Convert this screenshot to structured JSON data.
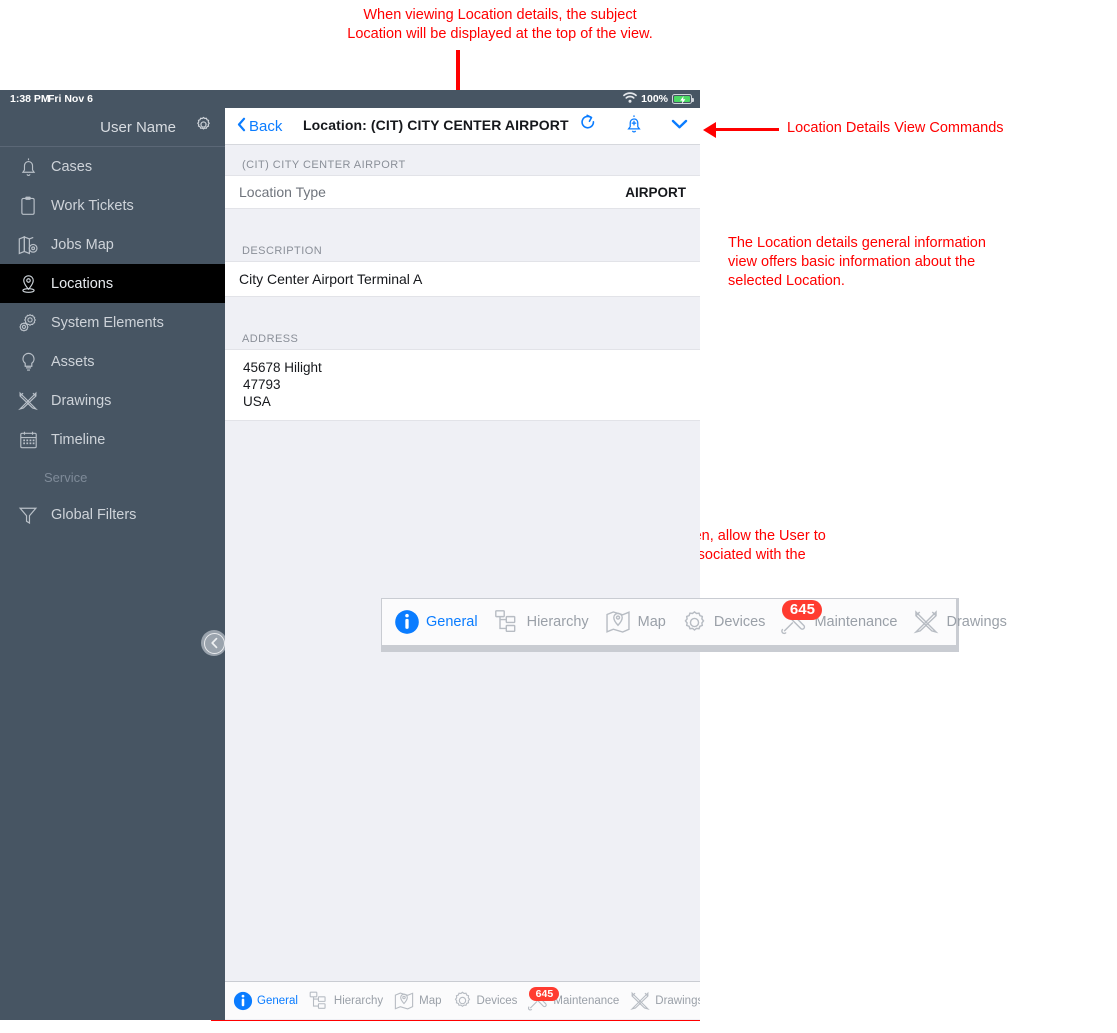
{
  "annotations": {
    "top": "When viewing Location details, the subject\nLocation will be displayed at the top of the view.",
    "commands": "Location Details View Commands",
    "general_info": "The Location details general information\nview offers basic information about the\nselected Location.",
    "view_options": "The view options, along the bottom of the screen, allow the User to\neasily navigate between records and details associated with the\nselected Location."
  },
  "statusbar": {
    "time": "1:38 PM",
    "date": "Fri Nov 6",
    "wifi_icon": "wifi-icon",
    "battery_pct": "100%",
    "battery_icon": "battery-charging-icon"
  },
  "sidebar": {
    "user_name": "User Name",
    "settings_icon": "gear-icon",
    "collapse_icon": "chevron-left-icon",
    "items": [
      {
        "label": "Cases",
        "icon": "bell-icon",
        "selected": false
      },
      {
        "label": "Work Tickets",
        "icon": "clipboard-icon",
        "selected": false
      },
      {
        "label": "Jobs Map",
        "icon": "map-icon",
        "selected": false
      },
      {
        "label": "Locations",
        "icon": "pin-icon",
        "selected": true
      },
      {
        "label": "System Elements",
        "icon": "gears-icon",
        "selected": false
      },
      {
        "label": "Assets",
        "icon": "bulb-icon",
        "selected": false
      },
      {
        "label": "Drawings",
        "icon": "drawings-icon",
        "selected": false
      },
      {
        "label": "Timeline",
        "icon": "calendar-icon",
        "selected": false
      }
    ],
    "section_label": "Service",
    "service_items": [
      {
        "label": "Global Filters",
        "icon": "funnel-icon"
      }
    ]
  },
  "navbar": {
    "back_label": "Back",
    "back_icon": "chevron-left-icon",
    "title": "Location: (CIT) CITY CENTER AIRPORT",
    "commands": [
      {
        "name": "refresh-icon",
        "label": "Refresh"
      },
      {
        "name": "alert-add-icon",
        "label": "Add Alert"
      },
      {
        "name": "chevron-down-icon",
        "label": "More"
      }
    ]
  },
  "details": {
    "section1_header": "(CIT) CITY CENTER AIRPORT",
    "location_type_label": "Location Type",
    "location_type_value": "AIRPORT",
    "description_header": "DESCRIPTION",
    "description_value": "City Center Airport Terminal A",
    "address_header": "ADDRESS",
    "address_lines": [
      "45678 Hilight",
      "47793",
      "USA"
    ]
  },
  "tabs": [
    {
      "label": "General",
      "icon": "info-icon",
      "selected": true,
      "badge": null
    },
    {
      "label": "Hierarchy",
      "icon": "hierarchy-icon",
      "selected": false,
      "badge": null
    },
    {
      "label": "Map",
      "icon": "map-pin-icon",
      "selected": false,
      "badge": null
    },
    {
      "label": "Devices",
      "icon": "gear-icon",
      "selected": false,
      "badge": null
    },
    {
      "label": "Maintenance",
      "icon": "wrench-icon",
      "selected": false,
      "badge": "645"
    },
    {
      "label": "Drawings",
      "icon": "drawings-icon",
      "selected": false,
      "badge": null
    }
  ],
  "colors": {
    "sidebar": "#475563",
    "selected_item": "#000000",
    "accent_blue": "#0a7cff",
    "annotation_red": "#ff0000",
    "badge_red": "#ff3b30",
    "content_bg": "#eff0f5"
  }
}
